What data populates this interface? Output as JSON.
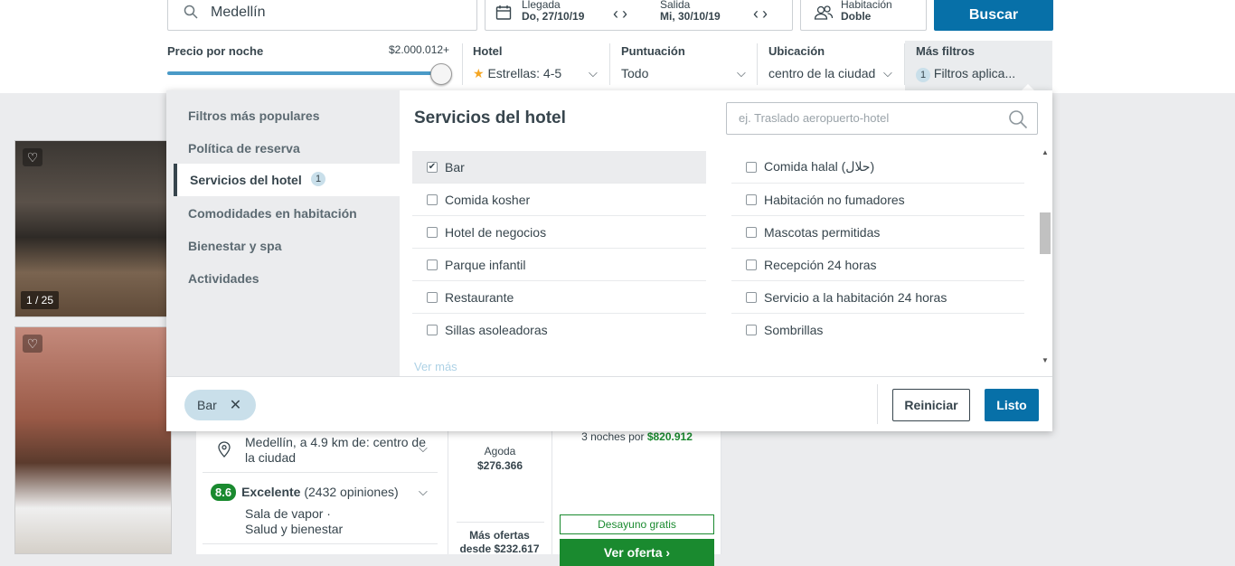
{
  "search": {
    "destination": "Medellín",
    "checkin_label": "Llegada",
    "checkin_value": "Do, 27/10/19",
    "checkout_label": "Salida",
    "checkout_value": "Mi, 30/10/19",
    "room_label": "Habitación",
    "room_value": "Doble",
    "search_button": "Buscar"
  },
  "filters": {
    "price_title": "Precio por noche",
    "price_value": "$2.000.012+",
    "price_fraction": 1.0,
    "hotel_title": "Hotel",
    "hotel_value": "Estrellas: 4-5",
    "rating_title": "Puntuación",
    "rating_value": "Todo",
    "location_title": "Ubicación",
    "location_value": "centro de la ciudad",
    "more_title": "Más filtros",
    "more_count": "1",
    "more_value": "Filtros aplica..."
  },
  "panel": {
    "categories": [
      {
        "label": "Filtros más populares"
      },
      {
        "label": "Política de reserva"
      },
      {
        "label": "Servicios del hotel",
        "count": "1"
      },
      {
        "label": "Comodidades en habitación"
      },
      {
        "label": "Bienestar y spa"
      },
      {
        "label": "Actividades"
      }
    ],
    "title": "Servicios del hotel",
    "search_placeholder": "ej. Traslado aeropuerto-hotel",
    "options_left": [
      {
        "label": "Bar",
        "checked": true
      },
      {
        "label": "Comida kosher",
        "checked": false
      },
      {
        "label": "Hotel de negocios",
        "checked": false
      },
      {
        "label": "Parque infantil",
        "checked": false
      },
      {
        "label": "Restaurante",
        "checked": false
      },
      {
        "label": "Sillas asoleadoras",
        "checked": false
      }
    ],
    "options_right": [
      {
        "label": "Comida halal (حلال)",
        "checked": false
      },
      {
        "label": "Habitación no fumadores",
        "checked": false
      },
      {
        "label": "Mascotas permitidas",
        "checked": false
      },
      {
        "label": "Recepción 24 horas",
        "checked": false
      },
      {
        "label": "Servicio a la habitación 24 horas",
        "checked": false
      },
      {
        "label": "Sombrillas",
        "checked": false
      }
    ],
    "see_more": "Ver más",
    "chip_label": "Bar",
    "reset_button": "Reiniciar",
    "done_button": "Listo"
  },
  "results": {
    "image_counter": "1 / 25",
    "location_text": "Medellín, a 4.9 km de: centro de la ciudad",
    "score": "8.6",
    "score_label": "Excelente",
    "reviews": "(2432 opiniones)",
    "amenity_1": "Sala de vapor ·",
    "amenity_2": "Salud y bienestar",
    "provider": "Agoda",
    "provider_price": "$276.366",
    "more_offers_1": "Más ofertas",
    "more_offers_2": "desde $232.617",
    "nights_text": "3 noches por",
    "nights_price": "$820.912",
    "breakfast": "Desayuno gratis",
    "view_offer": "Ver oferta"
  }
}
